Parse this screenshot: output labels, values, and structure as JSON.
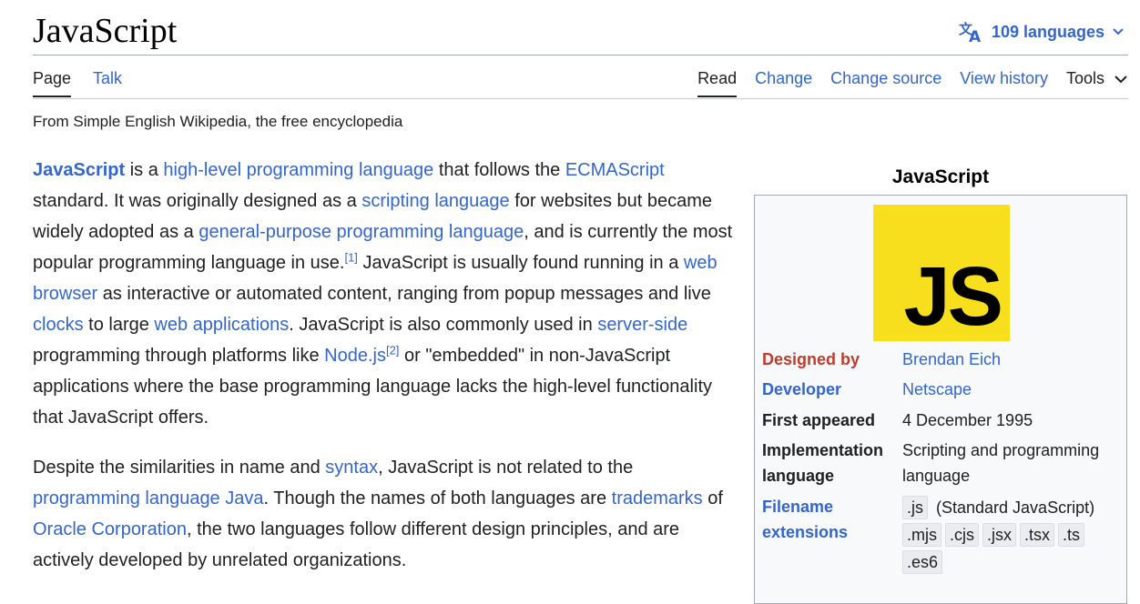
{
  "page": {
    "title": "JavaScript",
    "languages_label": "109 languages",
    "tabs_left": [
      "Page",
      "Talk"
    ],
    "tabs_right": [
      "Read",
      "Change",
      "Change source",
      "View history"
    ],
    "tools_label": "Tools",
    "tagline": "From Simple English Wikipedia, the free encyclopedia"
  },
  "article": {
    "p1": {
      "t1": "JavaScript",
      "t2": " is a ",
      "t3": "high-level programming language",
      "t4": " that follows the ",
      "t5": "ECMAScript",
      "t6": " standard. It was originally designed as a ",
      "t7": "scripting language",
      "t8": " for websites but became widely adopted as a ",
      "t9": "general-purpose programming language",
      "t10": ", and is currently the most popular programming language in use.",
      "ref1": "[1]",
      "t11": " JavaScript is usually found running in a ",
      "t12": "web browser",
      "t13": " as interactive or automated content, ranging from popup messages and live ",
      "t14": "clocks",
      "t15": " to large ",
      "t16": "web applications",
      "t17": ". JavaScript is also commonly used in ",
      "t18": "server-side",
      "t19": " programming through platforms like ",
      "t20": "Node.js",
      "ref2": "[2]",
      "t21": " or \"embedded\" in non-JavaScript applications where the base programming language lacks the high-level functionality that JavaScript offers."
    },
    "p2": {
      "t1": "Despite the similarities in name and ",
      "t2": "syntax",
      "t3": ", JavaScript is not related to the ",
      "t4": "programming language Java",
      "t5": ". Though the names of both languages are ",
      "t6": "trademarks",
      "t7": " of ",
      "t8": "Oracle Corporation",
      "t9": ", the two languages follow different design principles, and are actively developed by unrelated organizations."
    }
  },
  "infobox": {
    "title": "JavaScript",
    "logo_text": "JS",
    "logo_color": "#f7df1e",
    "designed_by_label": "Designed by",
    "designed_by_value": "Brendan Eich",
    "developer_label": "Developer",
    "developer_value": "Netscape",
    "first_appeared_label": "First appeared",
    "first_appeared_value": "4 December 1995",
    "implementation_label": "Implementation language",
    "implementation_value": "Scripting and programming language",
    "extensions_label": "Filename extensions",
    "ext_main": ".js",
    "ext_main_note": " (Standard JavaScript)",
    "ext_others": [
      ".mjs",
      ".cjs",
      ".jsx",
      ".tsx",
      ".ts",
      ".es6"
    ]
  },
  "colors": {
    "link": "#3366cc",
    "label_red": "#bf3c2c",
    "text": "#202122"
  }
}
